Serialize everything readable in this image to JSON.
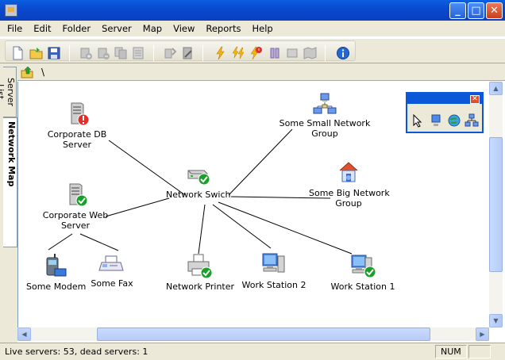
{
  "menu": [
    "File",
    "Edit",
    "Folder",
    "Server",
    "Map",
    "View",
    "Reports",
    "Help"
  ],
  "address": {
    "path": "\\"
  },
  "left_tabs": {
    "server_list": "Server List",
    "network_map": "Network Map"
  },
  "nodes": {
    "corporate_db": "Corporate DB Server",
    "small_group": "Some Small Network Group",
    "big_group": "Some Big Network Group",
    "network_switch": "Network Swich",
    "corporate_web": "Corporate Web Server",
    "modem": "Some Modem",
    "fax": "Some Fax",
    "printer": "Network Printer",
    "ws2": "Work Station 2",
    "ws1": "Work Station 1"
  },
  "node_lines": {
    "corporate_db": [
      "Corporate DB",
      "Server"
    ],
    "small_group": [
      "Some Small Network",
      "Group"
    ],
    "big_group": [
      "Some Big Network",
      "Group"
    ],
    "corporate_web": [
      "Corporate Web",
      "Server"
    ]
  },
  "status": {
    "text": "Live servers: 53, dead servers: 1",
    "num": "NUM"
  },
  "colors": {
    "title_bar": "#0a4ad0",
    "chrome": "#ece9d8",
    "ok_badge": "#1aa02a",
    "error_badge": "#e0302a"
  },
  "icons": {
    "db_server": "server-error-icon",
    "web_server": "server-ok-icon",
    "switch": "switch-ok-icon",
    "printer": "printer-ok-icon",
    "workstation": "workstation-icon"
  }
}
